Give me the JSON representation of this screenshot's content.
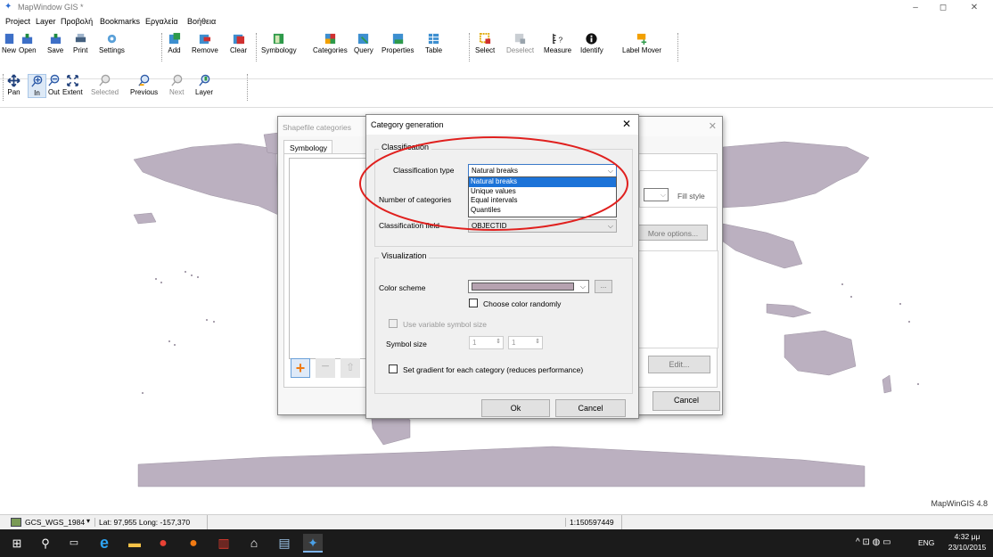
{
  "window": {
    "title": "MapWindow GIS *",
    "minimize": "–",
    "maximize": "◻",
    "close": "✕"
  },
  "menu": [
    "Project",
    "Layer",
    "Προβολή",
    "Bookmarks",
    "Εργαλεία",
    "Βοήθεια"
  ],
  "toolbar1": [
    {
      "label": "New",
      "icon": "new-icon",
      "color": "#3d6fc7"
    },
    {
      "label": "Open",
      "icon": "open-icon",
      "color": "#3d6fc7"
    },
    {
      "label": "Save",
      "icon": "save-icon",
      "color": "#3d6fc7"
    },
    {
      "label": "Print",
      "icon": "print-icon",
      "color": "#44607f"
    },
    {
      "label": "Settings",
      "icon": "settings-icon",
      "color": "#5aa0d8"
    },
    {
      "label": "Add",
      "icon": "add-layer-icon",
      "color": "#2e9a4a"
    },
    {
      "label": "Remove",
      "icon": "remove-layer-icon",
      "color": "#d03030"
    },
    {
      "label": "Clear",
      "icon": "clear-layers-icon",
      "color": "#d03030"
    },
    {
      "label": "Symbology",
      "icon": "symbology-icon",
      "color": "#2e9a4a"
    },
    {
      "label": "Categories",
      "icon": "categories-icon",
      "color": "#6c8fd0"
    },
    {
      "label": "Query",
      "icon": "query-icon",
      "color": "#3d8fd0"
    },
    {
      "label": "Properties",
      "icon": "properties-icon",
      "color": "#3d8fd0"
    },
    {
      "label": "Table",
      "icon": "table-icon",
      "color": "#3d8fd0"
    },
    {
      "label": "Select",
      "icon": "select-icon",
      "color": "#e0a800"
    },
    {
      "label": "Deselect",
      "icon": "deselect-icon",
      "color": "#9aa4ad"
    },
    {
      "label": "Measure",
      "icon": "measure-icon",
      "color": "#222"
    },
    {
      "label": "Identify",
      "icon": "identify-icon",
      "color": "#111"
    },
    {
      "label": "Label Mover",
      "icon": "label-mover-icon",
      "color": "#f2a000"
    }
  ],
  "toolbar2": [
    {
      "label": "Pan",
      "icon": "pan-icon",
      "enabled": true
    },
    {
      "label": "In",
      "icon": "zoom-in-icon",
      "enabled": true
    },
    {
      "label": "Out",
      "icon": "zoom-out-icon",
      "enabled": true
    },
    {
      "label": "Extent",
      "icon": "extent-icon",
      "enabled": true
    },
    {
      "label": "Selected",
      "icon": "zoom-selected-icon",
      "enabled": false
    },
    {
      "label": "Previous",
      "icon": "zoom-previous-icon",
      "enabled": true
    },
    {
      "label": "Next",
      "icon": "zoom-next-icon",
      "enabled": false
    },
    {
      "label": "Layer",
      "icon": "zoom-layer-icon",
      "enabled": true
    }
  ],
  "shapefile_dialog": {
    "title": "Shapefile categories",
    "close": "✕",
    "tab": "Symbology",
    "fill_style_label": "Fill style",
    "more_options": "More options...",
    "edit": "Edit...",
    "cancel": "Cancel"
  },
  "category_dialog": {
    "title": "Category generation",
    "close": "✕",
    "classification_group": "Classification",
    "classification_type_label": "Classification type",
    "classification_type_value": "Natural breaks",
    "dropdown_options": [
      "Natural breaks",
      "Unique values",
      "Equal intervals",
      "Quantiles"
    ],
    "number_of_categories_label": "Number of categories",
    "classification_field_label": "Classification field",
    "classification_field_value": "OBJECTID",
    "visualization_group": "Visualization",
    "color_scheme_label": "Color scheme",
    "color_scheme_color": "#b6a2b0",
    "browse_button": "...",
    "choose_color_randomly": "Choose color randomly",
    "use_variable_symbol_size": "Use variable symbol size",
    "symbol_size_label": "Symbol size",
    "symbol_size_from": "1",
    "symbol_size_to": "1",
    "set_gradient": "Set gradient for each category (reduces performance)",
    "ok": "Ok",
    "cancel": "Cancel"
  },
  "map": {
    "land_color": "#bbb0c0",
    "version": "MapWinGIS 4.8"
  },
  "status": {
    "projection": "GCS_WGS_1984",
    "coords": "Lat: 97,955 Long: -157,370",
    "scale": "1:150597449"
  },
  "taskbar": {
    "time": "4:32 μμ",
    "date": "23/10/2015",
    "lang": "ENG"
  },
  "highlight_color": "#e0201e"
}
